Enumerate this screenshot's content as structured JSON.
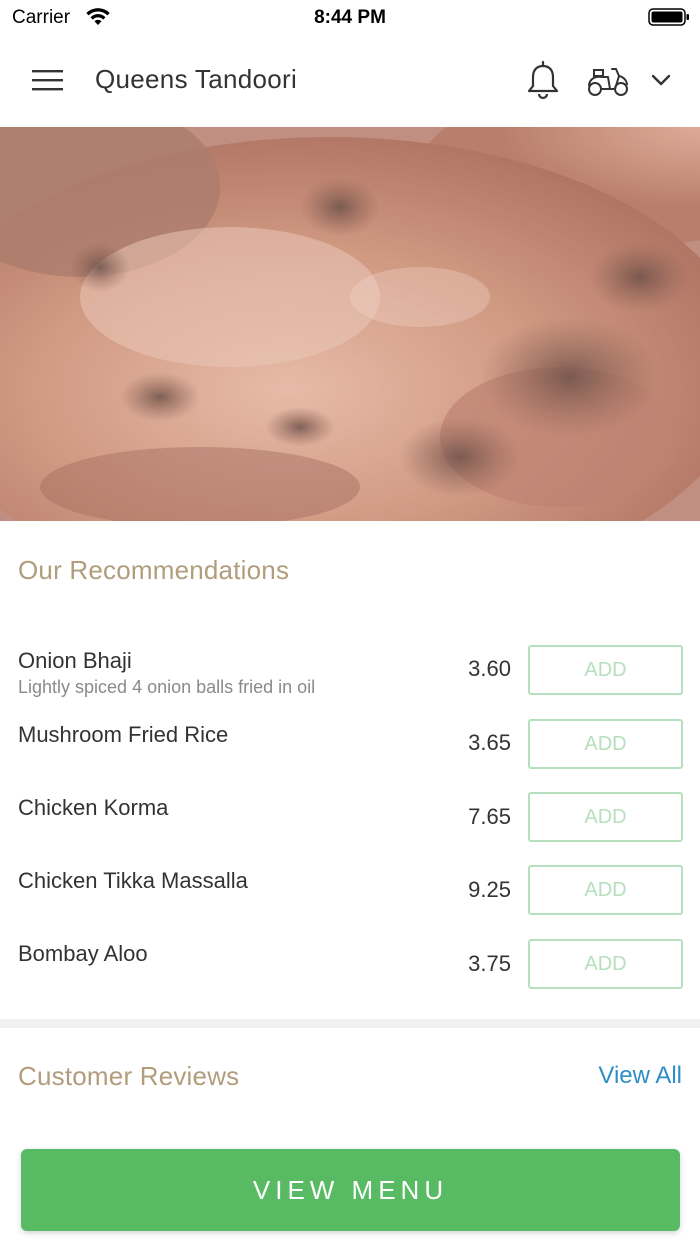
{
  "status_bar": {
    "carrier": "Carrier",
    "time": "8:44 PM"
  },
  "header": {
    "title": "Queens Tandoori",
    "icons": [
      "hamburger-menu-icon",
      "bell-icon",
      "scooter-delivery-icon",
      "chevron-down-icon"
    ]
  },
  "hero": {
    "image": "tandoori-chicken-photo"
  },
  "recommendations": {
    "title": "Our Recommendations",
    "add_label": "ADD",
    "items": [
      {
        "name": "Onion Bhaji",
        "description": "Lightly spiced 4 onion balls fried in oil",
        "price": "3.60"
      },
      {
        "name": "Mushroom Fried Rice",
        "description": "",
        "price": "3.65"
      },
      {
        "name": "Chicken Korma",
        "description": "",
        "price": "7.65"
      },
      {
        "name": "Chicken Tikka Massalla",
        "description": "",
        "price": "9.25"
      },
      {
        "name": "Bombay Aloo",
        "description": "",
        "price": "3.75"
      }
    ]
  },
  "reviews": {
    "title": "Customer Reviews",
    "view_all": "View All"
  },
  "footer": {
    "view_menu": "VIEW MENU"
  },
  "colors": {
    "accent_green": "#58ba63",
    "add_border": "#b6dfbd",
    "section_title": "#b19d7c",
    "link_blue": "#2e8fc6"
  }
}
